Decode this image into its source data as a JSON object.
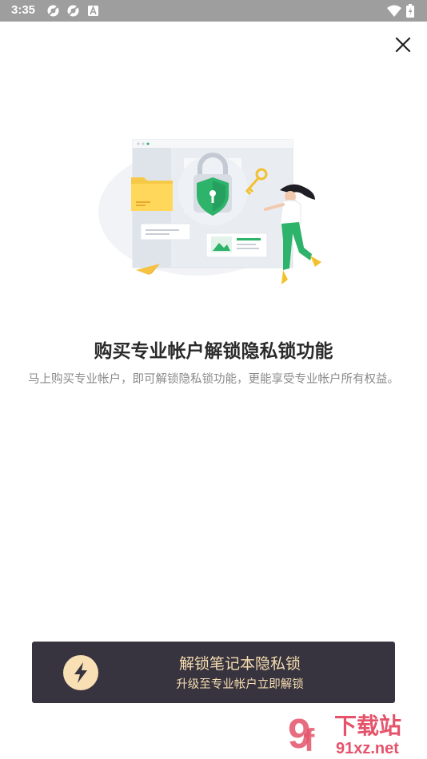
{
  "status_bar": {
    "time": "3:35"
  },
  "headline": "购买专业帐户解锁隐私锁功能",
  "description": "马上购买专业帐户，即可解锁隐私锁功能，更能享受专业帐户所有权益。",
  "cta": {
    "title": "解锁笔记本隐私锁",
    "subtitle": "升级至专业帐户立即解锁"
  },
  "watermark": {
    "brand": "下载站",
    "site": "91xz.net"
  },
  "colors": {
    "cta_bg": "#37343f",
    "cta_text": "#f6dcb0",
    "shield": "#2db36a"
  }
}
